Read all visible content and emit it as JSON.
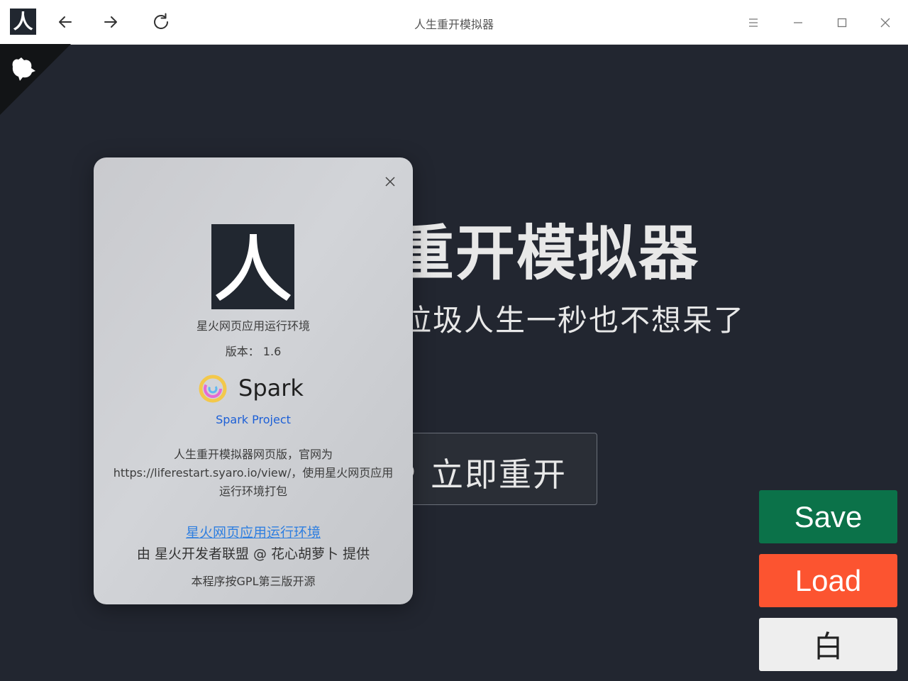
{
  "window": {
    "title": "人生重开模拟器",
    "app_logo_char": "人"
  },
  "toolbar": {
    "back_icon": "arrow-left-icon",
    "forward_icon": "arrow-right-icon",
    "reload_icon": "reload-icon",
    "menu_icon": "menu-icon",
    "minimize_icon": "minimize-icon",
    "maximize_icon": "maximize-icon",
    "close_icon": "close-icon"
  },
  "app": {
    "title": "人生重开模拟器",
    "subtitle": "这垃圾人生一秒也不想呆了",
    "restart_label": "立即重开",
    "save_label": "Save",
    "load_label": "Load",
    "theme_label": "白",
    "colors": {
      "background": "#222630",
      "save": "#0b7249",
      "load": "#fc5430",
      "theme": "#eeeeee"
    }
  },
  "about_dialog": {
    "runtime_name": "星火网页应用运行环境",
    "version_text": "版本：  1.6",
    "spark_word": "Spark",
    "project_link": "Spark Project",
    "description": "人生重开模拟器网页版，官网为https://liferestart.syaro.io/view/，使用星火网页应用运行环境打包",
    "runtime_link": "星火网页应用运行环境",
    "provided_by": "由 星火开发者联盟 @ 花心胡萝卜 提供",
    "license": "本程序按GPL第三版开源"
  }
}
